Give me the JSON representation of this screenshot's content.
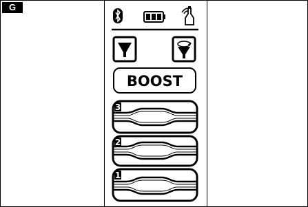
{
  "figure": {
    "label": "G"
  },
  "remote": {
    "status_icons": [
      "bluetooth-icon",
      "battery-icon",
      "wireless-sensor-icon"
    ],
    "buttons": {
      "left_icon": "funnel-down-icon",
      "right_icon": "funnel-rotate-icon",
      "boost_label": "BOOST"
    },
    "levels": [
      {
        "number": "3"
      },
      {
        "number": "2"
      },
      {
        "number": "1"
      }
    ],
    "colors": {
      "ink": "#000000",
      "background": "#ffffff"
    }
  }
}
